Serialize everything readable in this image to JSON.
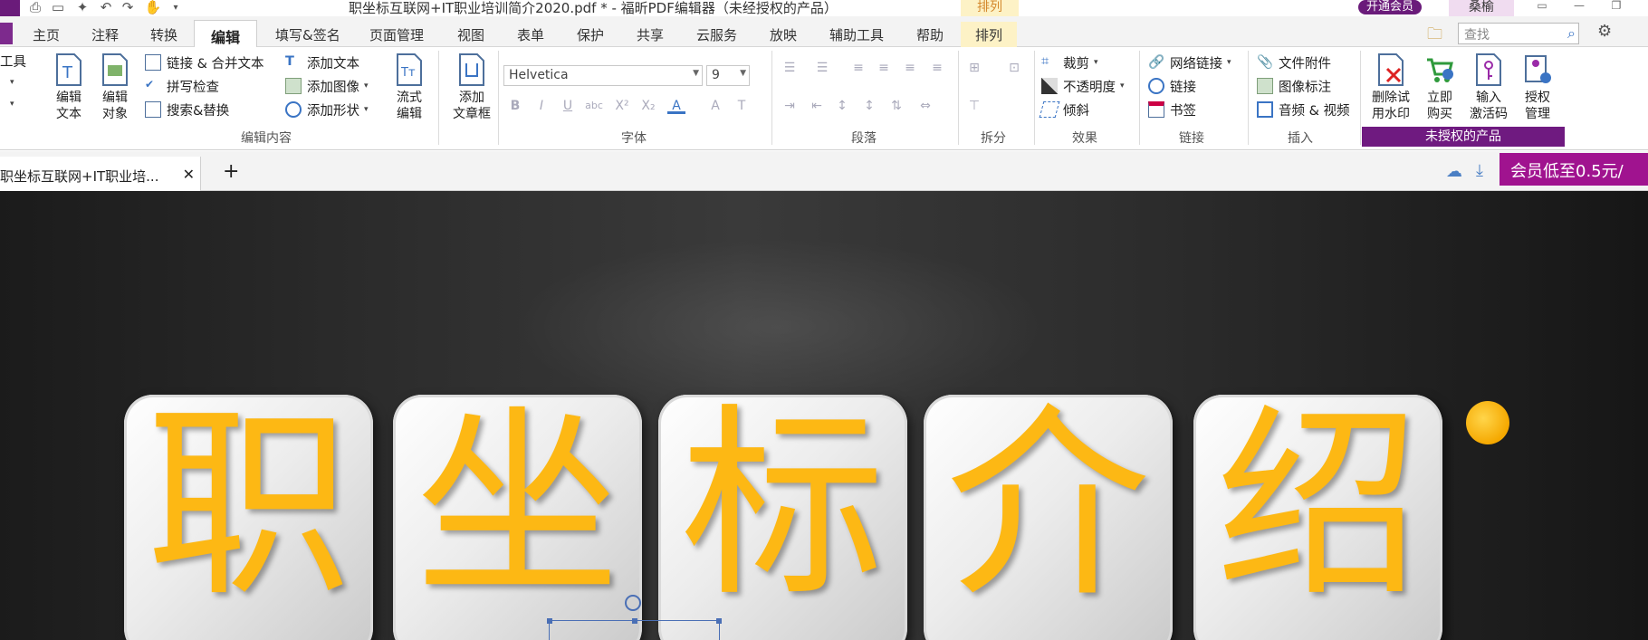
{
  "window": {
    "title": "职坐标互联网+IT职业培训简介2020.pdf * - 福昕PDF编辑器（未经授权的产品）",
    "context_tab_title": "排列",
    "member_button": "开通会员",
    "user_name": "桑榆"
  },
  "menu_tabs": [
    "主页",
    "注释",
    "转换",
    "编辑",
    "填写&签名",
    "页面管理",
    "视图",
    "表单",
    "保护",
    "共享",
    "云服务",
    "放映",
    "辅助工具",
    "帮助",
    "排列"
  ],
  "active_tab": "编辑",
  "search": {
    "placeholder": "查找"
  },
  "ribbon": {
    "tools": {
      "label": "工具"
    },
    "edit_content": {
      "label": "编辑内容",
      "edit_text": "编辑\n文本",
      "edit_object": "编辑\n对象",
      "link_merge": "链接 & 合并文本",
      "spell_check": "拼写检查",
      "search_replace": "搜索&替换",
      "add_text": "添加文本",
      "add_image": "添加图像",
      "add_shape": "添加形状",
      "flow_edit": "流式\n编辑",
      "add_article": "添加\n文章框"
    },
    "font": {
      "label": "字体",
      "family": "Helvetica",
      "size": "9"
    },
    "paragraph": {
      "label": "段落"
    },
    "split": {
      "label": "拆分"
    },
    "effects": {
      "label": "效果",
      "crop": "裁剪",
      "opacity": "不透明度",
      "skew": "倾斜"
    },
    "links": {
      "label": "链接",
      "web_link": "网络链接",
      "link": "链接",
      "bookmark": "书签"
    },
    "insert": {
      "label": "插入",
      "file_attachment": "文件附件",
      "image_annotation": "图像标注",
      "audio_video": "音频 & 视频"
    },
    "license": {
      "remove_watermark": "删除试\n用水印",
      "buy_now": "立即\n购买",
      "enter_code": "输入\n激活码",
      "manage": "授权\n管理",
      "unlicensed": "未授权的产品"
    }
  },
  "document_tab": {
    "title": "职坐标互联网+IT职业培...",
    "promo": "会员低至0.5元/"
  },
  "canvas": {
    "characters": [
      "职",
      "坐",
      "标",
      "介",
      "绍"
    ],
    "char_color": "#fdb814"
  },
  "colors": {
    "brand_purple": "#6a1b7a",
    "promo_magenta": "#a0138f",
    "accent_blue": "#3a74c4"
  }
}
